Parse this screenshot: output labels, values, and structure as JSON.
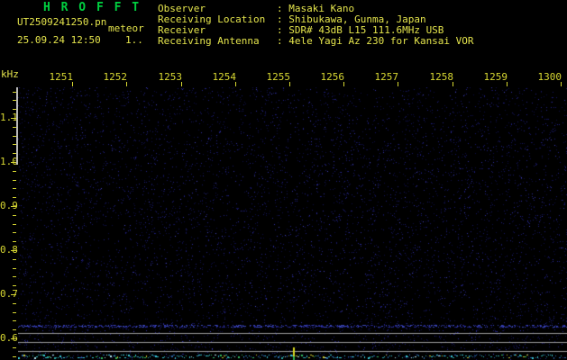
{
  "title": "H R O F F T",
  "header": {
    "filename": "UT2509241250.pn",
    "station": "meteor",
    "datetime": "25.09.24 12:50",
    "counter": "1..",
    "info": [
      {
        "label": "Observer",
        "value": "Masaki Kano"
      },
      {
        "label": "Receiving Location",
        "value": "Shibukawa, Gunma, Japan"
      },
      {
        "label": "Receiver",
        "value": "SDR# 43dB L15 111.6MHz USB"
      },
      {
        "label": "Receiving Antenna",
        "value": "4ele Yagi Az 230 for Kansai VOR"
      }
    ]
  },
  "axes": {
    "freq_unit": "kHz",
    "time_labels": [
      "1251",
      "1252",
      "1253",
      "1254",
      "1255",
      "1256",
      "1257",
      "1258",
      "1259",
      "1300"
    ],
    "freq_labels": [
      "1.1",
      "1.0",
      "0.9",
      "0.8",
      "0.7",
      "0.6"
    ]
  },
  "plot": {
    "type": "spectrogram",
    "time_range": [
      "12:50",
      "13:00"
    ],
    "freq_range_khz": [
      0.55,
      1.17
    ],
    "level_ref_lines": 3,
    "event_marker_x_fraction": 0.501
  },
  "colors": {
    "background": "#000000",
    "title_green": "#00d040",
    "text_yellow": "#e4e44c",
    "label_yellow": "#d8d832",
    "axis_gray": "#b8b8b8",
    "grid_gray": "#989898",
    "noise_palette": [
      "#0e0e44",
      "#181866",
      "#222288",
      "#3030a8",
      "#4848c8"
    ],
    "band_blue": "#3a46b8",
    "trace_cyan": "#38ccdc",
    "trace_dim": "#2a6ab0",
    "trace_teal": "#2aa8a8",
    "trace_white": "#b8eef6",
    "trace_green": "#30c060",
    "trace_yellow": "#c8c830",
    "spike_yellow": "#d8d820",
    "spike_green": "#28b050"
  }
}
